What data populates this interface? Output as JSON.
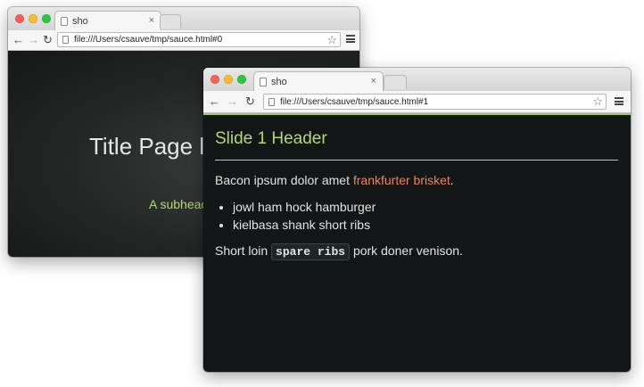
{
  "back_window": {
    "tab_title": "sho",
    "tab_close": "×",
    "url": "file:///Users/csauve/tmp/sauce.html#0",
    "slide_title": "Title Page l",
    "slide_subtitle": "A subhead"
  },
  "front_window": {
    "tab_title": "sho",
    "tab_close": "×",
    "url": "file:///Users/csauve/tmp/sauce.html#1",
    "slide_header": "Slide 1 Header",
    "para1_prefix": "Bacon ipsum dolor amet ",
    "para1_link": "frankfurter brisket",
    "para1_suffix": ".",
    "bullets": [
      "jowl ham hock hamburger",
      "kielbasa shank short ribs"
    ],
    "para2_prefix": "Short loin ",
    "para2_code": "spare ribs",
    "para2_suffix": " pork doner venison."
  },
  "icons": {
    "back": "←",
    "forward": "→",
    "reload": "↻",
    "star": "☆"
  },
  "colors": {
    "slide_accent": "#b5d873",
    "link": "#f0835b",
    "slide_background": "#121616"
  }
}
